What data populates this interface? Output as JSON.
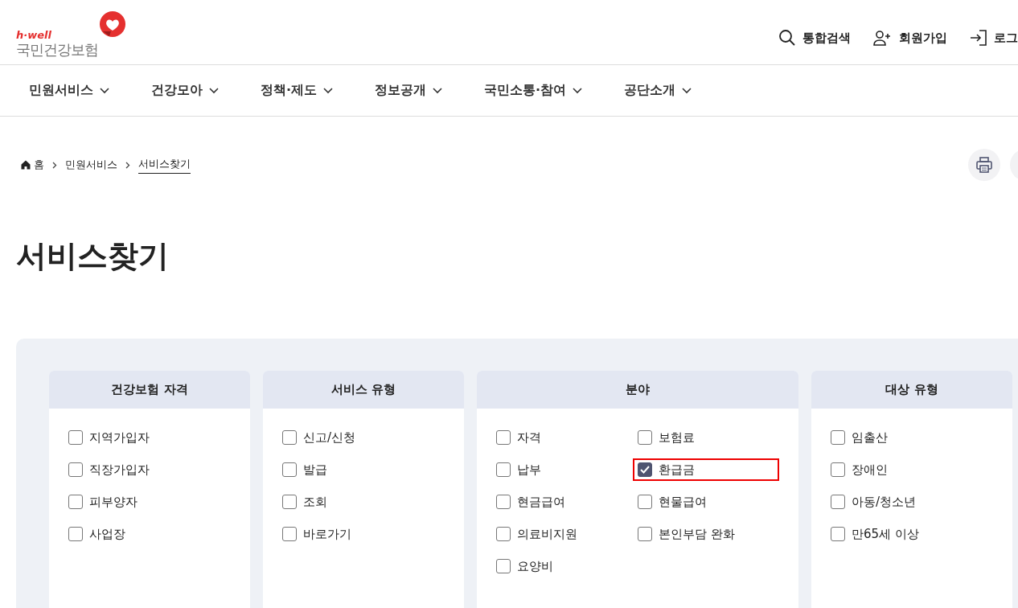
{
  "logo": {
    "tagline": "h·well",
    "name": "국민건강보험"
  },
  "header_links": [
    {
      "kind": "search",
      "label": "통합검색"
    },
    {
      "kind": "join",
      "label": "회원가입"
    },
    {
      "kind": "login",
      "label": "로그"
    }
  ],
  "nav": [
    "민원서비스",
    "건강모아",
    "정책·제도",
    "정보공개",
    "국민소통·참여",
    "공단소개"
  ],
  "breadcrumb": [
    "홈",
    "민원서비스",
    "서비스찾기"
  ],
  "title": "서비스찾기",
  "filters": [
    {
      "heading": "건강보험 자격",
      "columns": [
        [
          {
            "label": "지역가입자",
            "checked": false,
            "highlighted": false
          },
          {
            "label": "직장가입자",
            "checked": false,
            "highlighted": false
          },
          {
            "label": "피부양자",
            "checked": false,
            "highlighted": false
          },
          {
            "label": "사업장",
            "checked": false,
            "highlighted": false
          }
        ]
      ]
    },
    {
      "heading": "서비스 유형",
      "columns": [
        [
          {
            "label": "신고/신청",
            "checked": false,
            "highlighted": false
          },
          {
            "label": "발급",
            "checked": false,
            "highlighted": false
          },
          {
            "label": "조회",
            "checked": false,
            "highlighted": false
          },
          {
            "label": "바로가기",
            "checked": false,
            "highlighted": false
          }
        ]
      ]
    },
    {
      "heading": "분야",
      "columns": [
        [
          {
            "label": "자격",
            "checked": false,
            "highlighted": false
          },
          {
            "label": "납부",
            "checked": false,
            "highlighted": false
          },
          {
            "label": "현금급여",
            "checked": false,
            "highlighted": false
          },
          {
            "label": "의료비지원",
            "checked": false,
            "highlighted": false
          },
          {
            "label": "요양비",
            "checked": false,
            "highlighted": false
          }
        ],
        [
          {
            "label": "보험료",
            "checked": false,
            "highlighted": false
          },
          {
            "label": "환급금",
            "checked": true,
            "highlighted": true
          },
          {
            "label": "현물급여",
            "checked": false,
            "highlighted": false
          },
          {
            "label": "본인부담 완화",
            "checked": false,
            "highlighted": false
          }
        ]
      ]
    },
    {
      "heading": "대상 유형",
      "columns": [
        [
          {
            "label": "임출산",
            "checked": false,
            "highlighted": false
          },
          {
            "label": "장애인",
            "checked": false,
            "highlighted": false
          },
          {
            "label": "아동/청소년",
            "checked": false,
            "highlighted": false
          },
          {
            "label": "만65세 이상",
            "checked": false,
            "highlighted": false
          }
        ]
      ]
    }
  ]
}
